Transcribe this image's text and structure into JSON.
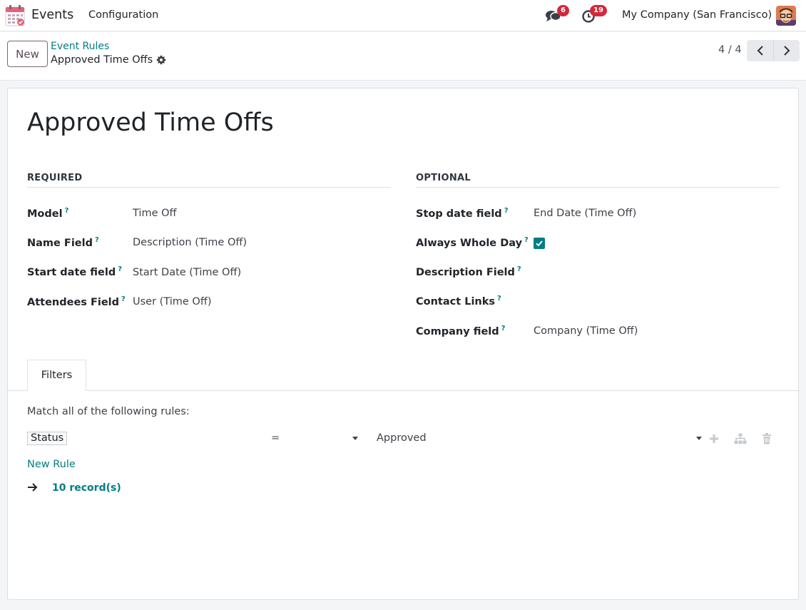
{
  "navbar": {
    "app_name": "Events",
    "menu_configuration": "Configuration",
    "messages_count": "6",
    "activities_count": "19",
    "company": "My Company (San Francisco)"
  },
  "control_panel": {
    "new_button": "New",
    "breadcrumb_parent": "Event Rules",
    "breadcrumb_current": "Approved Time Offs",
    "pager": "4 / 4"
  },
  "record": {
    "title": "Approved Time Offs",
    "required_group": {
      "heading": "REQUIRED",
      "fields": [
        {
          "label": "Model",
          "value": "Time Off"
        },
        {
          "label": "Name Field",
          "value": "Description (Time Off)"
        },
        {
          "label": "Start date field",
          "value": "Start Date (Time Off)"
        },
        {
          "label": "Attendees Field",
          "value": "User (Time Off)"
        }
      ]
    },
    "optional_group": {
      "heading": "OPTIONAL",
      "fields": [
        {
          "label": "Stop date field",
          "value": "End Date (Time Off)"
        },
        {
          "label": "Always Whole Day",
          "value": true
        },
        {
          "label": "Description Field",
          "value": ""
        },
        {
          "label": "Contact Links",
          "value": ""
        },
        {
          "label": "Company field",
          "value": "Company (Time Off)"
        }
      ]
    },
    "help_marker": "?"
  },
  "notebook": {
    "tab_filters": "Filters",
    "match_text": "Match all of the following rules:",
    "rule": {
      "field": "Status",
      "operator": "=",
      "value": "Approved"
    },
    "new_rule": "New Rule",
    "records_count": "10 record(s)"
  },
  "colors": {
    "accent": "#017e84",
    "badge": "#d3283a",
    "brand": "#714b67"
  }
}
